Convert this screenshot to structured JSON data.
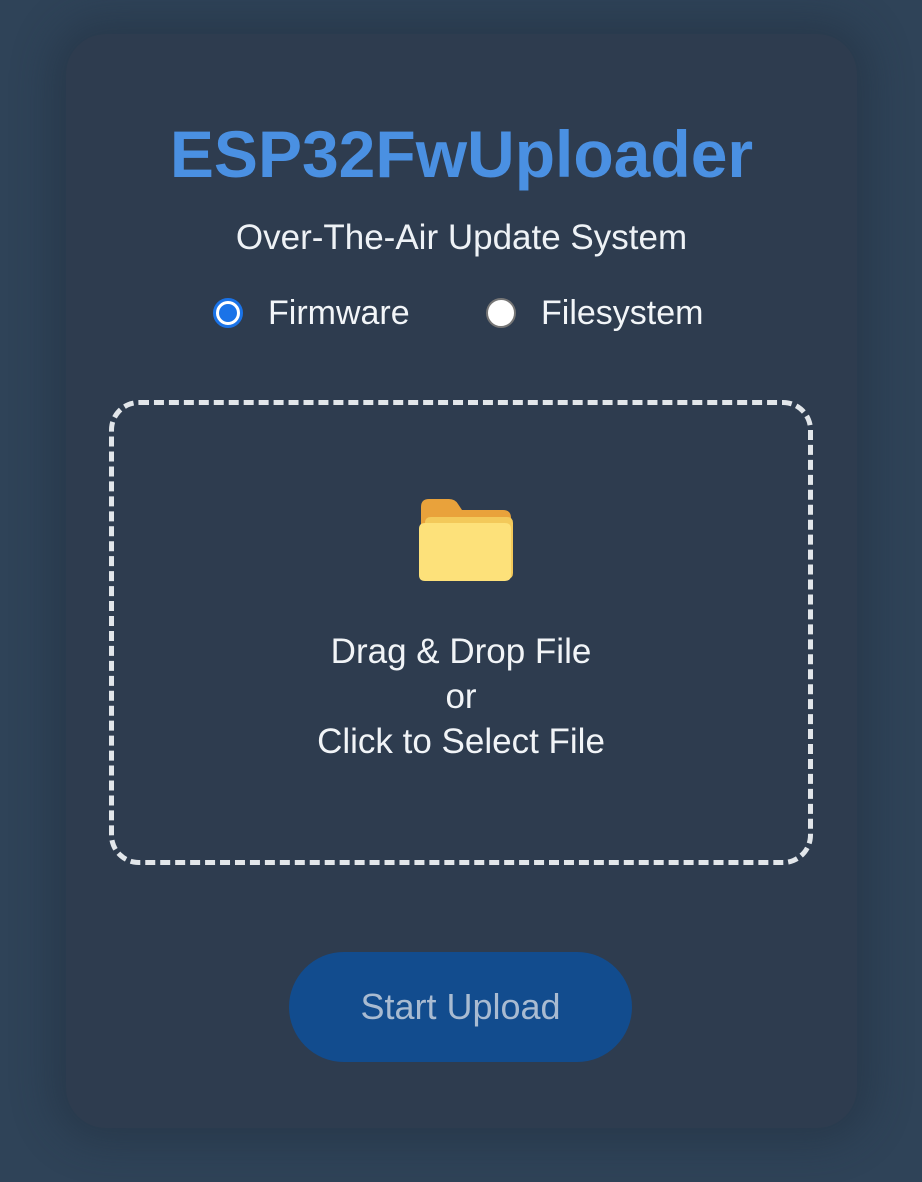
{
  "header": {
    "title": "ESP32FwUploader",
    "subtitle": "Over-The-Air Update System"
  },
  "update_type": {
    "options": [
      {
        "label": "Firmware",
        "checked": true
      },
      {
        "label": "Filesystem",
        "checked": false
      }
    ]
  },
  "dropzone": {
    "icon": "folder-icon",
    "line1": "Drag & Drop File",
    "line2": "or",
    "line3": "Click to Select File"
  },
  "upload_button": {
    "label": "Start Upload"
  },
  "colors": {
    "accent": "#4a90e2",
    "radio_checked": "#1a73e8",
    "button_bg": "#124c8e",
    "page_bg": "#2f4358",
    "card_bg": "#2e3c4f"
  }
}
